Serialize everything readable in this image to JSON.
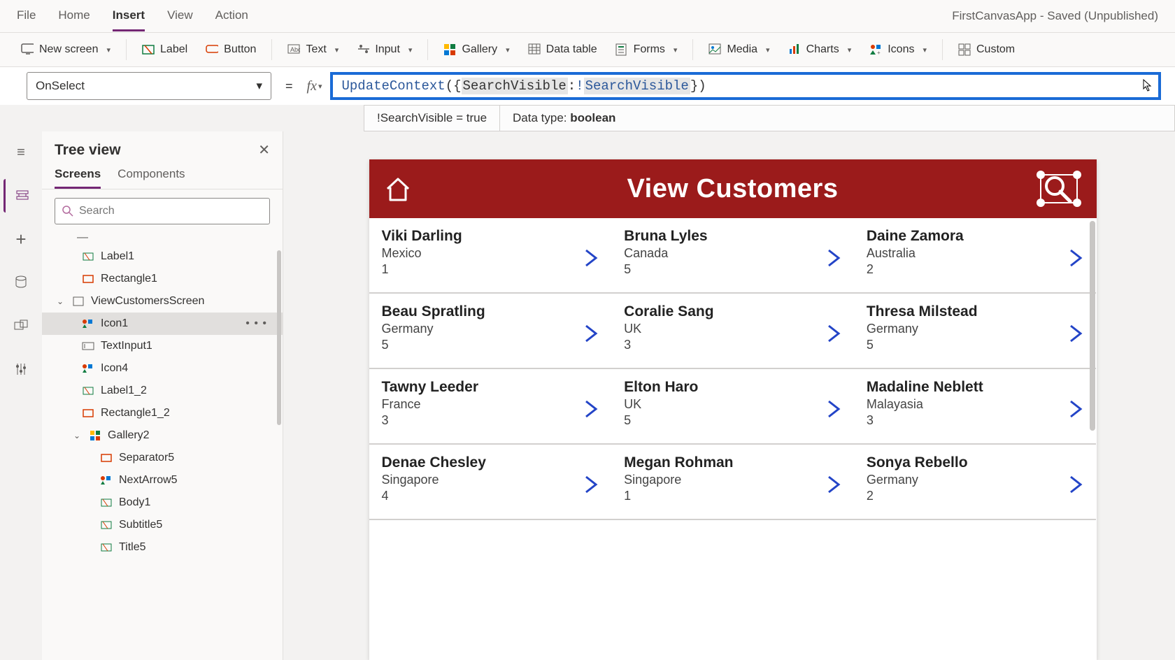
{
  "window": {
    "title": "FirstCanvasApp - Saved (Unpublished)"
  },
  "menu": {
    "file": "File",
    "home": "Home",
    "insert": "Insert",
    "view": "View",
    "action": "Action"
  },
  "ribbon": {
    "newscreen": "New screen",
    "label": "Label",
    "button": "Button",
    "text": "Text",
    "input": "Input",
    "gallery": "Gallery",
    "datatable": "Data table",
    "forms": "Forms",
    "media": "Media",
    "charts": "Charts",
    "icons": "Icons",
    "custom": "Custom"
  },
  "formula": {
    "property": "OnSelect",
    "fn": "UpdateContext",
    "key": "SearchVisible",
    "var": "SearchVisible",
    "hint_eval": "!SearchVisible  =  true",
    "hint_type_label": "Data type: ",
    "hint_type": "boolean"
  },
  "tree": {
    "title": "Tree view",
    "tabs": {
      "screens": "Screens",
      "components": "Components"
    },
    "search_placeholder": "Search",
    "dash": "—",
    "items": {
      "label1": "Label1",
      "rectangle1": "Rectangle1",
      "viewcustomers": "ViewCustomersScreen",
      "icon1": "Icon1",
      "textinput1": "TextInput1",
      "icon4": "Icon4",
      "label1_2": "Label1_2",
      "rectangle1_2": "Rectangle1_2",
      "gallery2": "Gallery2",
      "separator5": "Separator5",
      "nextarrow5": "NextArrow5",
      "body1": "Body1",
      "subtitle5": "Subtitle5",
      "title5": "Title5"
    }
  },
  "preview": {
    "title": "View Customers",
    "cells": [
      {
        "name": "Viki  Darling",
        "country": "Mexico",
        "num": "1"
      },
      {
        "name": "Bruna  Lyles",
        "country": "Canada",
        "num": "5"
      },
      {
        "name": "Daine  Zamora",
        "country": "Australia",
        "num": "2"
      },
      {
        "name": "Beau  Spratling",
        "country": "Germany",
        "num": "5"
      },
      {
        "name": "Coralie  Sang",
        "country": "UK",
        "num": "3"
      },
      {
        "name": "Thresa  Milstead",
        "country": "Germany",
        "num": "5"
      },
      {
        "name": "Tawny  Leeder",
        "country": "France",
        "num": "3"
      },
      {
        "name": "Elton  Haro",
        "country": "UK",
        "num": "5"
      },
      {
        "name": "Madaline  Neblett",
        "country": "Malayasia",
        "num": "3"
      },
      {
        "name": "Denae  Chesley",
        "country": "Singapore",
        "num": "4"
      },
      {
        "name": "Megan  Rohman",
        "country": "Singapore",
        "num": "1"
      },
      {
        "name": "Sonya  Rebello",
        "country": "Germany",
        "num": "2"
      }
    ]
  }
}
